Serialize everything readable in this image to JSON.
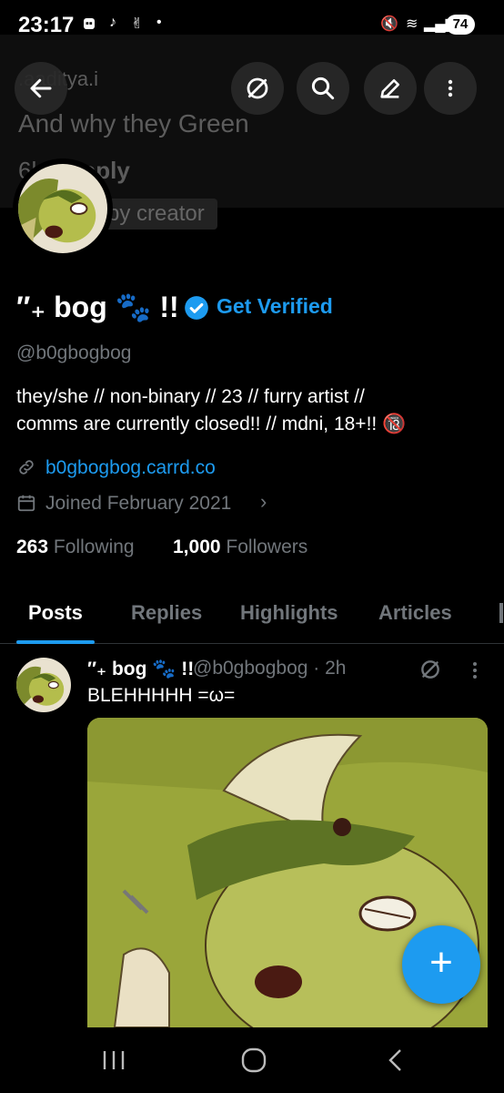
{
  "status_bar": {
    "time": "23:17",
    "battery": "74"
  },
  "background_reply": {
    "name": ".aaditya.i",
    "message": "And why they Green",
    "time": "6h",
    "reply_label": "Reply",
    "tag": "by creator"
  },
  "top_bar": {
    "icons": [
      "back-arrow-icon",
      "grok-icon",
      "search-icon",
      "edit-icon",
      "more-vertical-icon"
    ]
  },
  "profile": {
    "display_name": "″₊ bog 🐾 !!",
    "get_verified": "Get Verified",
    "handle": "@b0gbogbog",
    "bio_line1": "they/she // non-binary // 23 // furry artist //",
    "bio_line2": "comms are currently closed!! // mdni, 18+!! 🔞",
    "link": "b0gbogbog.carrd.co",
    "joined": "Joined February 2021",
    "following_count": "263",
    "following_label": "Following",
    "followers_count": "1,000",
    "followers_label": "Followers"
  },
  "tabs": [
    {
      "label": "Posts",
      "active": true
    },
    {
      "label": "Replies",
      "active": false
    },
    {
      "label": "Highlights",
      "active": false
    },
    {
      "label": "Articles",
      "active": false
    }
  ],
  "post": {
    "author": "″₊ bog 🐾 !!",
    "meta": "@b0gbogbog · 2h",
    "text": "BLEHHHHH =ω="
  },
  "fab_label": "+",
  "colors": {
    "accent": "#1d9bf0",
    "background": "#000000",
    "secondary_text": "#71767b",
    "character_green": "#9aa63a"
  }
}
